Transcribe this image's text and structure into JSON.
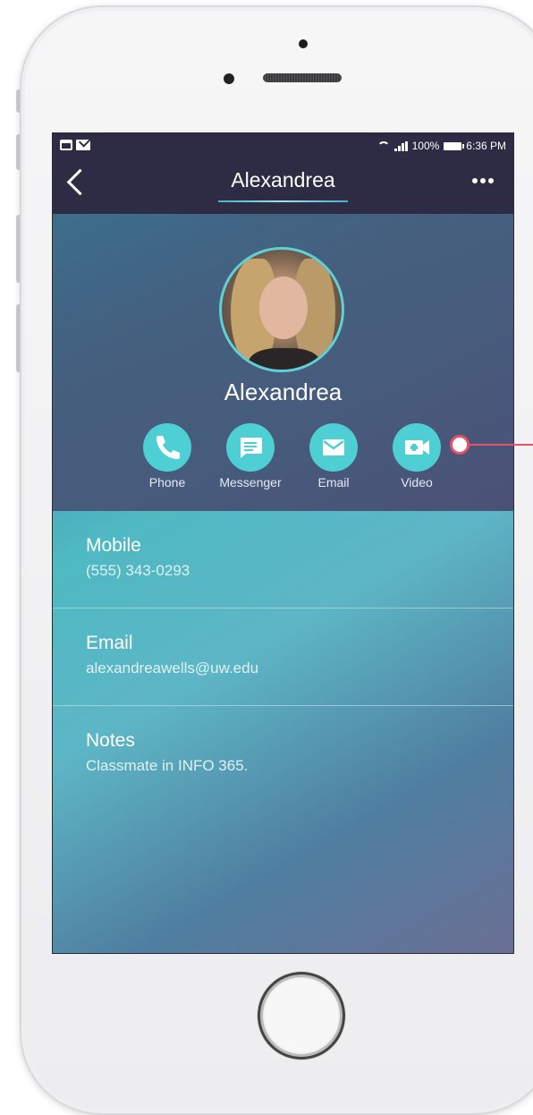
{
  "status_bar": {
    "battery": "100%",
    "time": "6:36 PM"
  },
  "header": {
    "title": "Alexandrea"
  },
  "profile": {
    "name": "Alexandrea",
    "actions": [
      {
        "label": "Phone",
        "icon": "phone-icon"
      },
      {
        "label": "Messenger",
        "icon": "message-icon"
      },
      {
        "label": "Email",
        "icon": "mail-icon"
      },
      {
        "label": "Video",
        "icon": "video-icon"
      }
    ]
  },
  "details": [
    {
      "title": "Mobile",
      "value": "(555) 343-0293"
    },
    {
      "title": "Email",
      "value": "alexandreawells@uw.edu"
    },
    {
      "title": "Notes",
      "value": "Classmate in INFO 365."
    }
  ],
  "colors": {
    "accent": "#4ecfd4",
    "header": "#2e2c45",
    "annotation": "#e6526a"
  }
}
